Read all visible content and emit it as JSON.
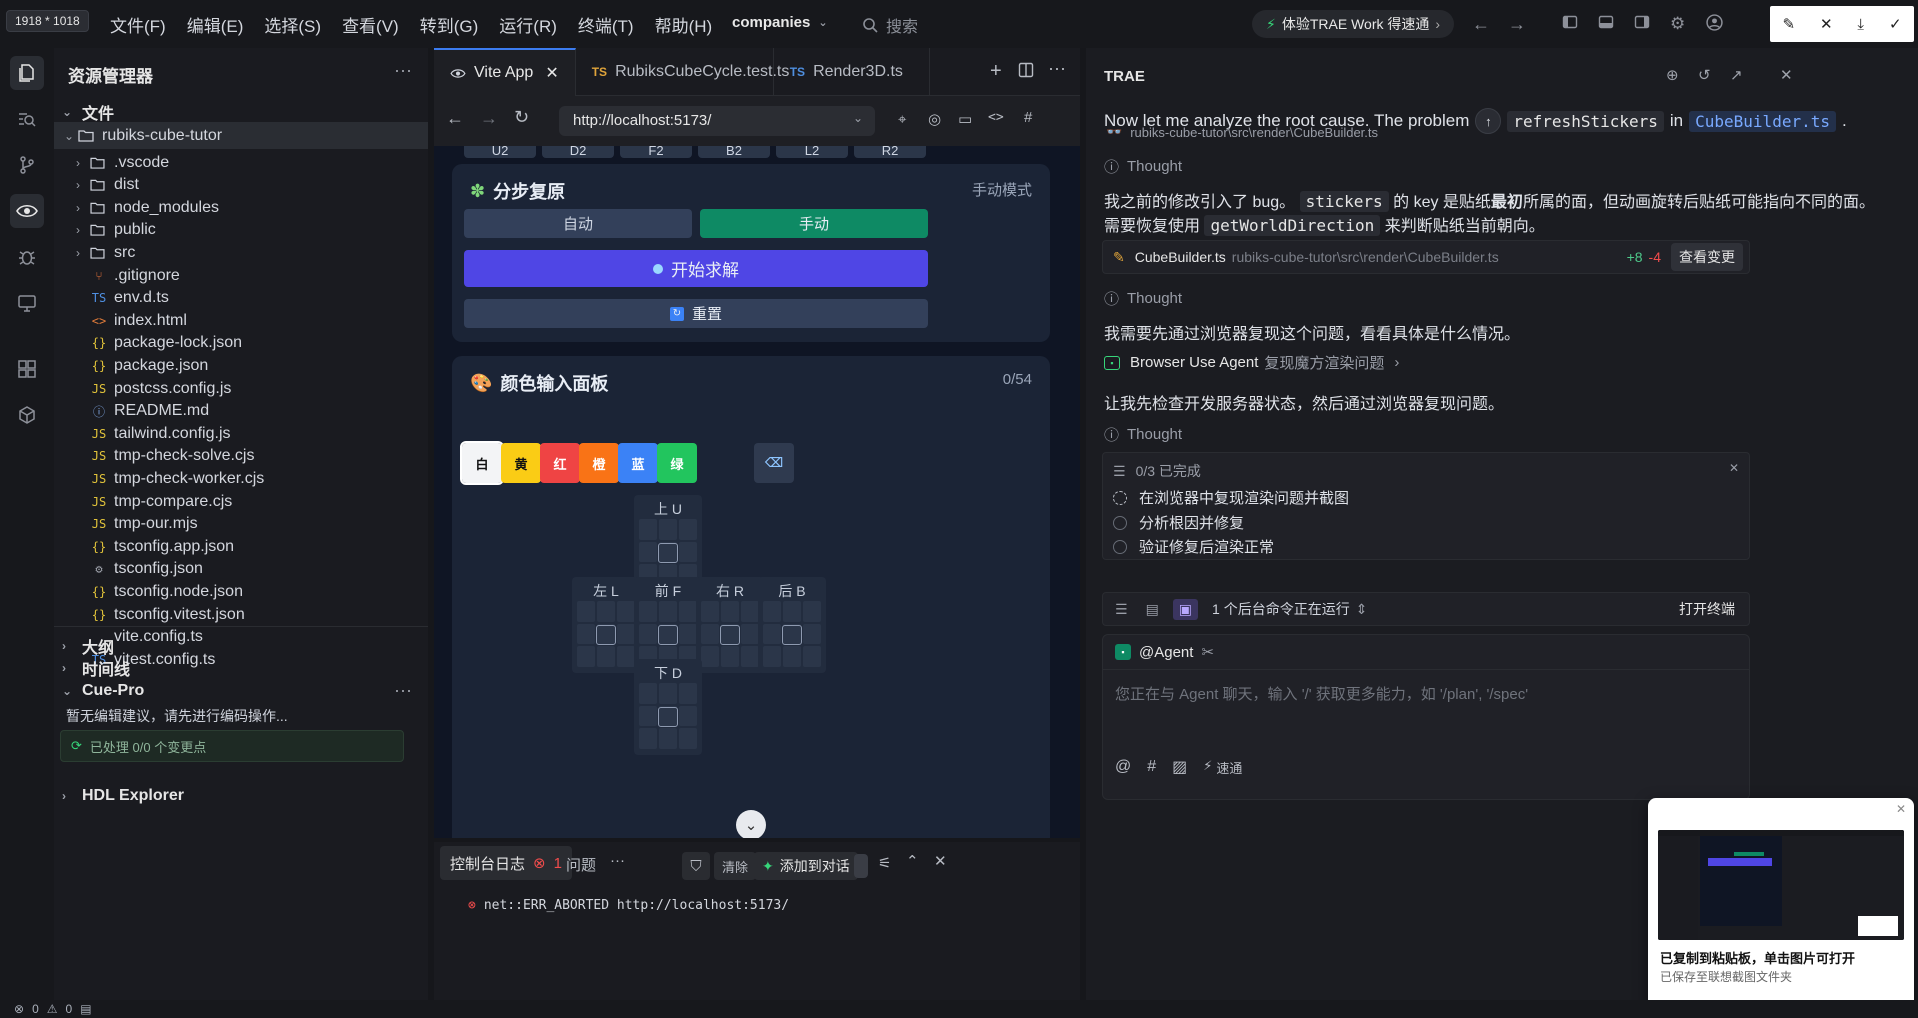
{
  "window": {
    "dimension_badge": "1918 * 1018"
  },
  "menu": [
    "文件(F)",
    "编辑(E)",
    "选择(S)",
    "查看(V)",
    "转到(G)",
    "运行(R)",
    "终端(T)",
    "帮助(H)"
  ],
  "project_name": "companies",
  "search_placeholder": "搜索",
  "promo_text": "体验TRAE Work 得速通",
  "explorer": {
    "title": "资源管理器",
    "files_section": "文件",
    "root_folder": "rubiks-cube-tutor",
    "items": [
      {
        "name": ".vscode",
        "type": "folder",
        "icon": ""
      },
      {
        "name": "dist",
        "type": "folder",
        "icon": ""
      },
      {
        "name": "node_modules",
        "type": "folder",
        "icon": ""
      },
      {
        "name": "public",
        "type": "folder",
        "icon": ""
      },
      {
        "name": "src",
        "type": "folder",
        "icon": ""
      },
      {
        "name": ".gitignore",
        "type": "file",
        "icon": "⑂"
      },
      {
        "name": "env.d.ts",
        "type": "file",
        "icon": "TS"
      },
      {
        "name": "index.html",
        "type": "file",
        "icon": "<>"
      },
      {
        "name": "package-lock.json",
        "type": "file",
        "icon": "{}"
      },
      {
        "name": "package.json",
        "type": "file",
        "icon": "{}"
      },
      {
        "name": "postcss.config.js",
        "type": "file",
        "icon": "JS"
      },
      {
        "name": "README.md",
        "type": "file",
        "icon": "ⓘ"
      },
      {
        "name": "tailwind.config.js",
        "type": "file",
        "icon": "JS"
      },
      {
        "name": "tmp-check-solve.cjs",
        "type": "file",
        "icon": "JS"
      },
      {
        "name": "tmp-check-worker.cjs",
        "type": "file",
        "icon": "JS"
      },
      {
        "name": "tmp-compare.cjs",
        "type": "file",
        "icon": "JS"
      },
      {
        "name": "tmp-our.mjs",
        "type": "file",
        "icon": "JS"
      },
      {
        "name": "tsconfig.app.json",
        "type": "file",
        "icon": "{}"
      },
      {
        "name": "tsconfig.json",
        "type": "file",
        "icon": "⚙"
      },
      {
        "name": "tsconfig.node.json",
        "type": "file",
        "icon": "{}"
      },
      {
        "name": "tsconfig.vitest.json",
        "type": "file",
        "icon": "{}"
      },
      {
        "name": "vite.config.ts",
        "type": "file",
        "icon": ""
      },
      {
        "name": "vitest.config.ts",
        "type": "file",
        "icon": "TS"
      }
    ],
    "outline": "大纲",
    "timeline": "时间线",
    "cue_pro": "Cue-Pro",
    "cue_msg": "暂无编辑建议，请先进行编码操作...",
    "cue_status": "已处理 0/0 个变更点",
    "hdl": "HDL Explorer"
  },
  "browser": {
    "tabs": [
      {
        "label": "Vite App",
        "icon": "eye-icon"
      },
      {
        "label": "RubiksCubeCycle.test.ts",
        "icon": "TS"
      },
      {
        "label": "Render3D.ts",
        "icon": "TS"
      }
    ],
    "url": "http://localhost:5173/",
    "top_buttons": [
      "U2",
      "D2",
      "F2",
      "B2",
      "L2",
      "R2"
    ],
    "step_card": {
      "title": "分步复原",
      "mode": "手动模式",
      "auto_btn": "自动",
      "manual_btn": "手动",
      "solve_btn": "开始求解",
      "reset_btn": "重置"
    },
    "color_card": {
      "title": "颜色输入面板",
      "count": "0/54",
      "colors": [
        {
          "label": "白",
          "color": "#f3f4f6",
          "text": "#111111"
        },
        {
          "label": "黄",
          "color": "#facc15",
          "text": "#111111"
        },
        {
          "label": "红",
          "color": "#ef4444",
          "text": "#ffffff"
        },
        {
          "label": "橙",
          "color": "#f97316",
          "text": "#ffffff"
        },
        {
          "label": "蓝",
          "color": "#3b82f6",
          "text": "#ffffff"
        },
        {
          "label": "绿",
          "color": "#22c55e",
          "text": "#ffffff"
        }
      ],
      "faces": [
        "上 U",
        "左 L",
        "前 F",
        "右 R",
        "后 B",
        "下 D"
      ]
    }
  },
  "console": {
    "tab_log": "控制台日志",
    "error_count": "1",
    "tab_problems": "问题",
    "more": "···",
    "clear": "清除",
    "add_chat": "添加到对话",
    "error_line": "net::ERR_ABORTED http://localhost:5173/"
  },
  "chat": {
    "title": "TRAE",
    "msg1_pre": "Now let me analyze the root cause. The problem",
    "msg1_code": "refreshStickers",
    "msg1_in": "in",
    "msg1_link": "CubeBuilder.ts",
    "msg1_end": ".",
    "path1": "rubiks-cube-tutor\\src\\render\\CubeBuilder.ts",
    "thought": "Thought",
    "msg2_a": "我之前的修改引入了 bug。",
    "msg2_code": "stickers",
    "msg2_b": "的 key 是贴纸",
    "msg2_bold": "最初",
    "msg2_c": "所属的面，但动画旋转后贴纸可能指向不同的面。",
    "msg3_a": "需要恢复使用",
    "msg3_code": "getWorldDirection",
    "msg3_b": "来判断贴纸当前朝向。",
    "file_card": {
      "name": "CubeBuilder.ts",
      "path": "rubiks-cube-tutor\\src\\render\\CubeBuilder.ts",
      "added": "+8",
      "removed": "-4",
      "button": "查看变更"
    },
    "msg4": "我需要先通过浏览器复现这个问题，看看具体是什么情况。",
    "agent_label": "Browser Use Agent",
    "agent_task": "复现魔方渲染问题",
    "msg5": "让我先检查开发服务器状态，然后通过浏览器复现问题。",
    "todo": {
      "header": "0/3 已完成",
      "items": [
        "在浏览器中复现渲染问题并截图",
        "分析根因并修复",
        "验证修复后渲染正常"
      ]
    },
    "running": "1 个后台命令正在运行",
    "open_terminal": "打开终端",
    "agent_mention": "@Agent",
    "input_placeholder": "您正在与 Agent 聊天，输入 '/' 获取更多能力，如 '/plan', '/spec'",
    "speed": "速通"
  },
  "toast": {
    "title": "已复制到粘贴板，单击图片可打开",
    "sub": "已保存至联想截图文件夹"
  },
  "status": {
    "errors": "0",
    "warnings": "0"
  }
}
